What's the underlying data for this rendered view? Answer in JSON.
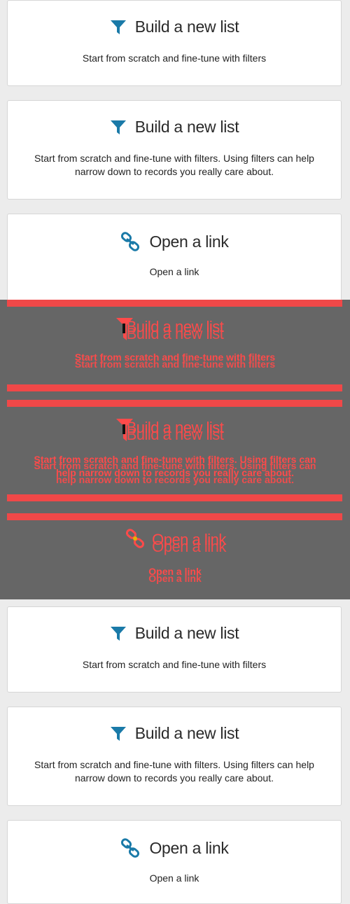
{
  "cards": [
    {
      "title": "Build a new list",
      "icon": "filter-icon",
      "description": "Start from scratch and fine-tune with filters"
    },
    {
      "title": "Build a new list",
      "icon": "filter-icon",
      "description": "Start from scratch and fine-tune with filters. Using filters can help narrow down to records you really care about."
    },
    {
      "title": "Open a link",
      "icon": "link-icon",
      "description": "Open a link"
    },
    {
      "title": "Build a new list",
      "icon": "filter-icon",
      "description": "Start from scratch and fine-tune with filters"
    },
    {
      "title": "Build a new list",
      "icon": "filter-icon",
      "description": "Start from scratch and fine-tune with filters. Using filters can help narrow down to records you really care about."
    },
    {
      "title": "Open a link",
      "icon": "link-icon",
      "description": "Open a link"
    }
  ],
  "overlay": {
    "cards": [
      {
        "title": "Build a new list",
        "description": "Start from scratch and fine-tune with filters"
      },
      {
        "title": "Build a new list",
        "description_line1": "Start from scratch and fine-tune with filters. Using filters can",
        "description_line2": "help narrow down to records you really care about."
      },
      {
        "title": "Open a link",
        "description": "Open a link"
      }
    ]
  },
  "colors": {
    "accent": "#1a7aa8",
    "overlay": "#666666",
    "overlay_text": "#ff4a4a",
    "card_border": "#d6d6d6",
    "page_bg": "#ececec"
  }
}
